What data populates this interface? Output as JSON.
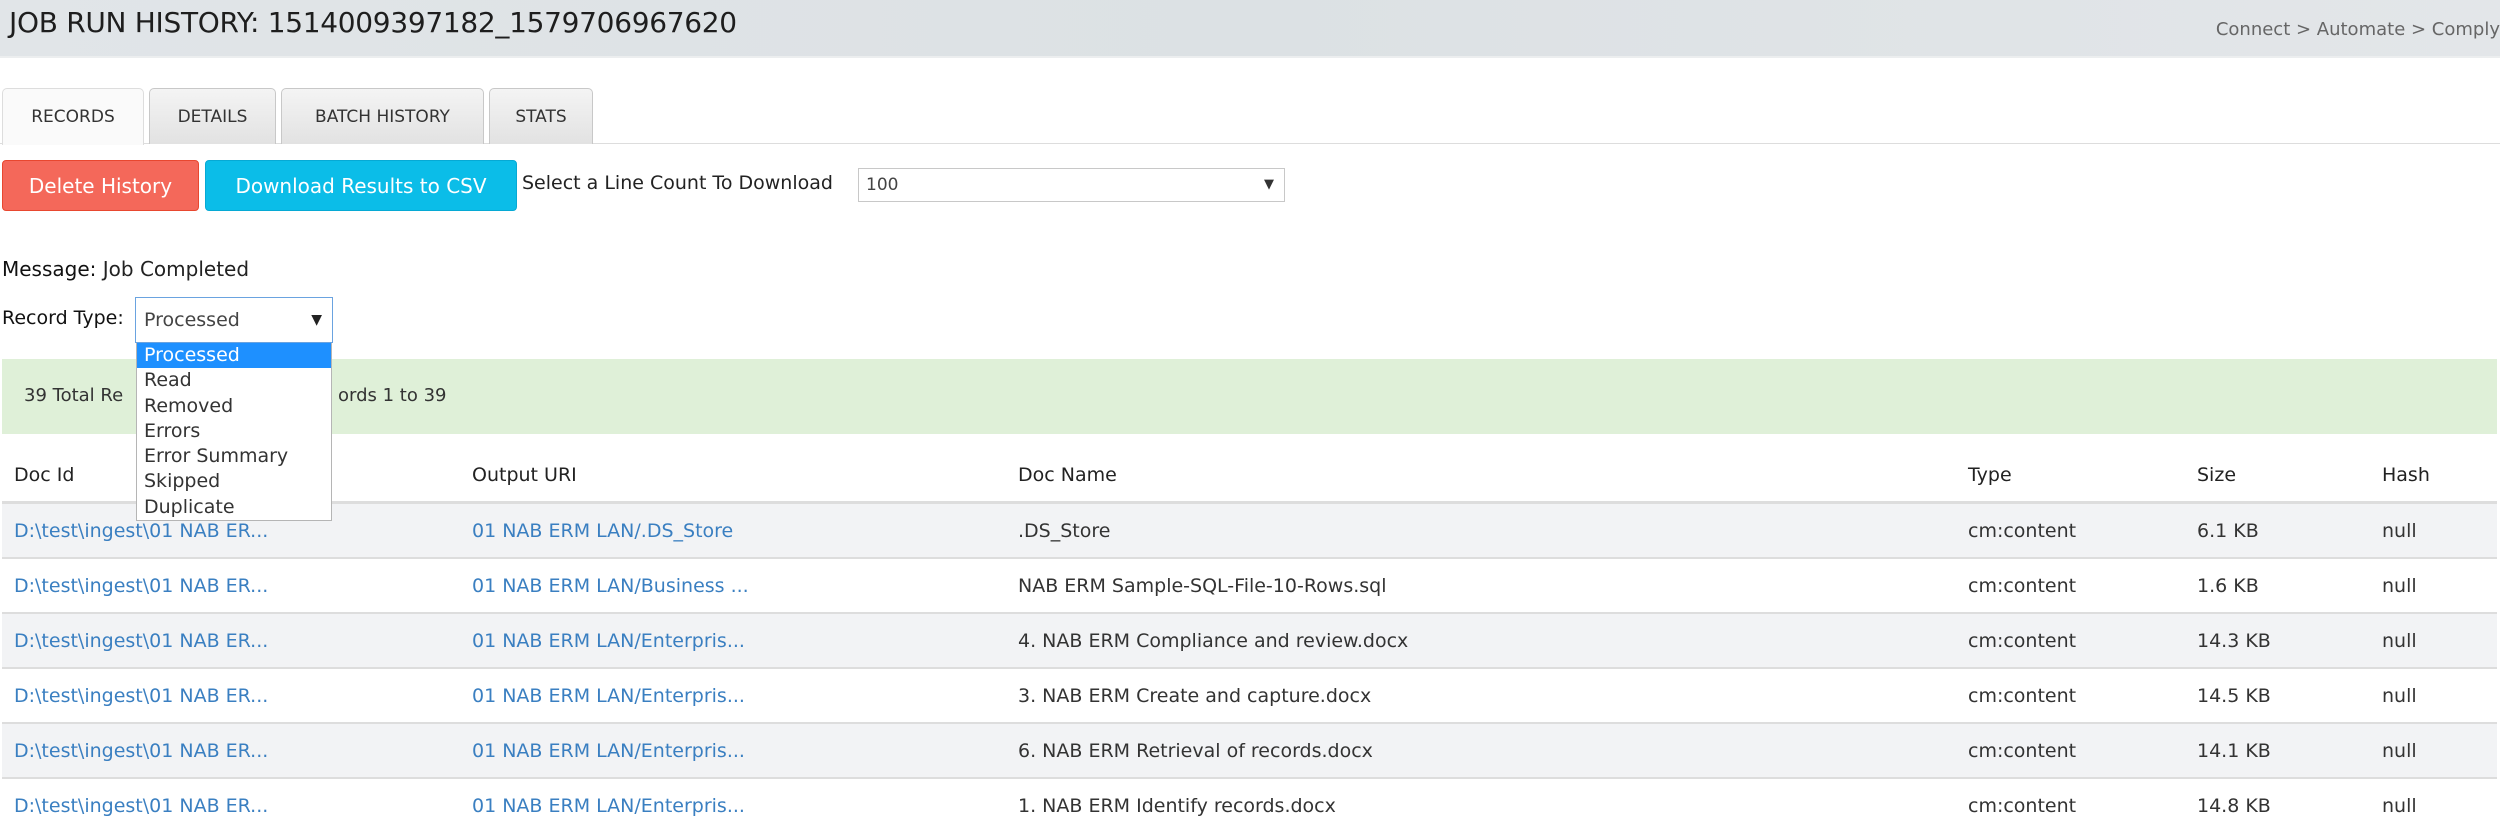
{
  "header": {
    "title": "JOB RUN HISTORY: 1514009397182_1579706967620",
    "breadcrumb": "Connect > Automate > Comply"
  },
  "tabs": [
    {
      "label": "RECORDS",
      "active": true
    },
    {
      "label": "DETAILS",
      "active": false
    },
    {
      "label": "BATCH HISTORY",
      "active": false
    },
    {
      "label": "STATS",
      "active": false
    }
  ],
  "actions": {
    "delete_label": "Delete History",
    "download_label": "Download Results to CSV",
    "line_count_label": "Select a Line Count To Download",
    "line_count_value": "100",
    "caret_glyph": "▼"
  },
  "colors": {
    "delete": "#f4685a",
    "download": "#0bbde8",
    "link": "#3a7fc1",
    "alert_bg": "#dff0d8",
    "selected_option": "#1e90ff"
  },
  "message": {
    "label": "Message:",
    "value": "Job Completed"
  },
  "record_type": {
    "label": "Record Type:",
    "value": "Processed",
    "options": [
      "Processed",
      "Read",
      "Removed",
      "Errors",
      "Error Summary",
      "Skipped",
      "Duplicate"
    ],
    "selected_index": 0
  },
  "alert": {
    "text_visible_left": "39 Total Re",
    "text_visible_right": "ords 1 to 39"
  },
  "table": {
    "headers": [
      "Doc Id",
      "Output URI",
      "Doc Name",
      "Type",
      "Size",
      "Hash"
    ],
    "rows": [
      [
        "D:\\test\\ingest\\01 NAB ER...",
        "01 NAB ERM LAN/.DS_Store",
        ".DS_Store",
        "cm:content",
        "6.1 KB",
        "null"
      ],
      [
        "D:\\test\\ingest\\01 NAB ER...",
        "01 NAB ERM LAN/Business ...",
        "NAB ERM Sample-SQL-File-10-Rows.sql",
        "cm:content",
        "1.6 KB",
        "null"
      ],
      [
        "D:\\test\\ingest\\01 NAB ER...",
        "01 NAB ERM LAN/Enterpris...",
        "4. NAB ERM Compliance and review.docx",
        "cm:content",
        "14.3 KB",
        "null"
      ],
      [
        "D:\\test\\ingest\\01 NAB ER...",
        "01 NAB ERM LAN/Enterpris...",
        "3. NAB ERM Create and capture.docx",
        "cm:content",
        "14.5 KB",
        "null"
      ],
      [
        "D:\\test\\ingest\\01 NAB ER...",
        "01 NAB ERM LAN/Enterpris...",
        "6. NAB ERM Retrieval of records.docx",
        "cm:content",
        "14.1 KB",
        "null"
      ],
      [
        "D:\\test\\ingest\\01 NAB ER...",
        "01 NAB ERM LAN/Enterpris...",
        "1. NAB ERM Identify records.docx",
        "cm:content",
        "14.8 KB",
        "null"
      ]
    ]
  }
}
